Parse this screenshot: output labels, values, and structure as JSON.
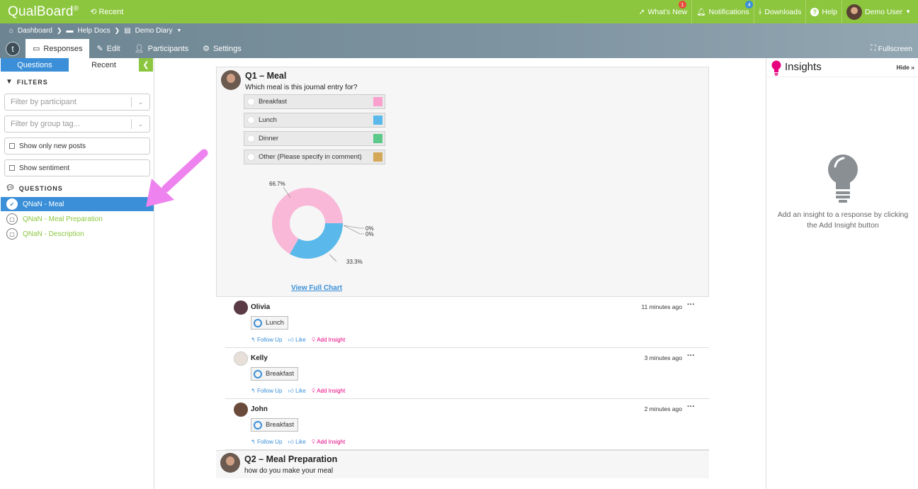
{
  "topbar": {
    "logo": "QualBoard",
    "logo_mark": "®",
    "recent": "Recent",
    "whats_new": "What's New",
    "whats_new_badge": "1",
    "notifications": "Notifications",
    "notifications_badge": "4",
    "downloads": "Downloads",
    "help": "Help",
    "user": "Demo User"
  },
  "breadcrumb": {
    "dashboard": "Dashboard",
    "help_docs": "Help Docs",
    "demo_diary": "Demo Diary"
  },
  "tabs": {
    "logo_letter": "t",
    "responses": "Responses",
    "edit": "Edit",
    "participants": "Participants",
    "settings": "Settings",
    "fullscreen": "Fullscreen"
  },
  "leftpanel": {
    "tab_questions": "Questions",
    "tab_recent": "Recent",
    "filters_label": "FILTERS",
    "filter_participant_placeholder": "Filter by participant",
    "filter_group_placeholder": "Filter by group tag...",
    "show_new": "Show only new posts",
    "show_sentiment": "Show sentiment",
    "questions_label": "QUESTIONS",
    "questions": [
      {
        "label": "QNaN - Meal",
        "active": true
      },
      {
        "label": "QNaN - Meal Preparation",
        "active": false
      },
      {
        "label": "QNaN - Description",
        "active": false
      }
    ]
  },
  "q1": {
    "title": "Q1 – Meal",
    "subtitle": "Which meal is this journal entry for?",
    "options": [
      {
        "label": "Breakfast",
        "color": "#f9a0cf"
      },
      {
        "label": "Lunch",
        "color": "#5ab9ea"
      },
      {
        "label": "Dinner",
        "color": "#5cc98a"
      },
      {
        "label": "Other (Please specify in comment)",
        "color": "#d3a857"
      }
    ],
    "view_full_chart": "View Full Chart"
  },
  "chart_data": {
    "type": "pie",
    "categories": [
      "Breakfast",
      "Lunch",
      "Dinner",
      "Other (Please specify in comment)"
    ],
    "values": [
      66.7,
      33.3,
      0,
      0
    ],
    "data_labels": [
      "66.7%",
      "33.3%",
      "0%",
      "0%"
    ],
    "colors": [
      "#f9b8d8",
      "#5ab9ea",
      "#5cc98a",
      "#d3a857"
    ]
  },
  "responses": [
    {
      "name": "Olivia",
      "time": "11 minutes ago",
      "answer": "Lunch",
      "follow_up": "Follow Up",
      "like": "Like",
      "add_insight": "Add Insight"
    },
    {
      "name": "Kelly",
      "time": "3 minutes ago",
      "answer": "Breakfast",
      "follow_up": "Follow Up",
      "like": "Like",
      "add_insight": "Add Insight"
    },
    {
      "name": "John",
      "time": "2 minutes ago",
      "answer": "Breakfast",
      "follow_up": "Follow Up",
      "like": "Like",
      "add_insight": "Add Insight"
    }
  ],
  "q2": {
    "title": "Q2 – Meal Preparation",
    "subtitle": "how do you make your meal"
  },
  "insights": {
    "title": "Insights",
    "hide": "Hide",
    "empty_text": "Add an insight to a response by clicking the Add Insight button"
  },
  "colors": {
    "brand_green": "#8cc63f",
    "accent_blue": "#3a8fd8",
    "insight_pink": "#e6007e",
    "arrow_pink": "#ee82ee"
  }
}
